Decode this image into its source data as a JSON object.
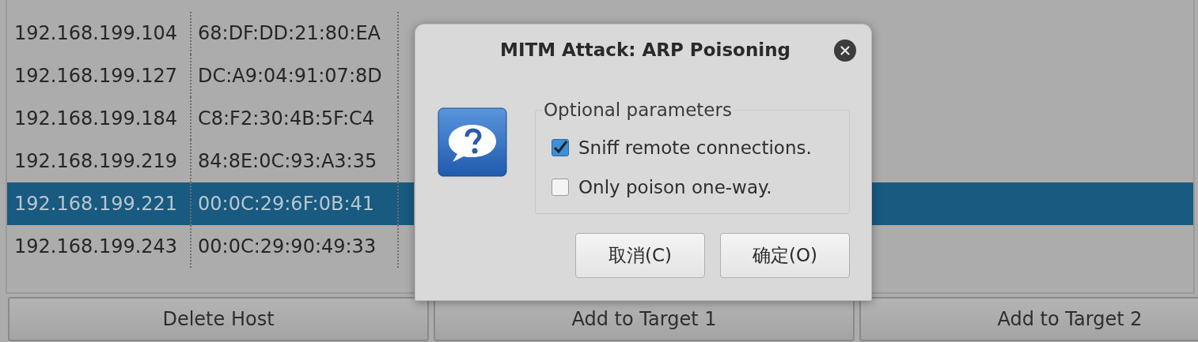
{
  "hosts": [
    {
      "ip": "192.168.199.104",
      "mac": "68:DF:DD:21:80:EA",
      "selected": false
    },
    {
      "ip": "192.168.199.127",
      "mac": "DC:A9:04:91:07:8D",
      "selected": false
    },
    {
      "ip": "192.168.199.184",
      "mac": "C8:F2:30:4B:5F:C4",
      "selected": false
    },
    {
      "ip": "192.168.199.219",
      "mac": "84:8E:0C:93:A3:35",
      "selected": false
    },
    {
      "ip": "192.168.199.221",
      "mac": "00:0C:29:6F:0B:41",
      "selected": true
    },
    {
      "ip": "192.168.199.243",
      "mac": "00:0C:29:90:49:33",
      "selected": false
    }
  ],
  "buttons": [
    "Delete Host",
    "Add to Target 1",
    "Add to Target 2"
  ],
  "dialog": {
    "title": "MITM Attack: ARP Poisoning",
    "group_label": "Optional parameters",
    "options": [
      {
        "label": "Sniff remote connections.",
        "checked": true
      },
      {
        "label": "Only poison one-way.",
        "checked": false
      }
    ],
    "buttons": [
      "取消(C)",
      "确定(O)"
    ]
  }
}
